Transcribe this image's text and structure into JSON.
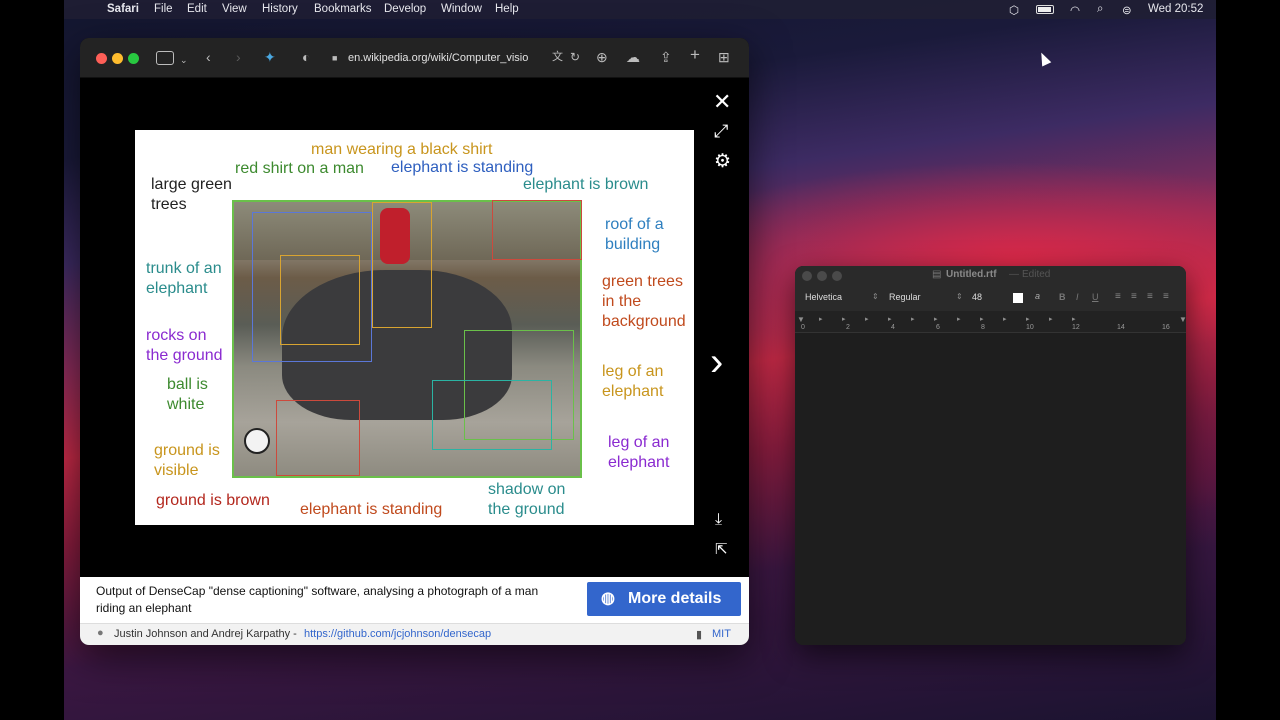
{
  "menubar": {
    "app": "Safari",
    "items": [
      "File",
      "Edit",
      "View",
      "History",
      "Bookmarks",
      "Develop",
      "Window",
      "Help"
    ],
    "clock": "Wed 20:52"
  },
  "safari": {
    "url": "en.wikipedia.org/wiki/Computer_visio"
  },
  "viewer": {
    "labels": [
      "man wearing a black shirt",
      "red shirt on a man",
      "elephant is standing",
      "large green",
      "trees",
      "elephant is brown",
      "roof of a",
      "building",
      "trunk of an",
      "elephant",
      "green trees",
      "in the",
      "background",
      "rocks on",
      "the ground",
      "ball is",
      "white",
      "leg of an",
      "elephant",
      "ground is",
      "visible",
      "leg of an",
      "elephant",
      "ground is brown",
      "elephant is standing",
      "shadow on",
      "the ground"
    ],
    "caption": "Output of DenseCap \"dense captioning\" software, analysing a photograph of a man riding an elephant",
    "more_details": "More details",
    "credit_author": "Justin Johnson and Andrej Karpathy - ",
    "credit_link": "https://github.com/jcjohnson/densecap",
    "license": "MIT"
  },
  "textedit": {
    "title": "Untitled.rtf",
    "status": "Edited",
    "font": "Helvetica",
    "style": "Regular",
    "size": "48",
    "ruler": [
      "0",
      "2",
      "4",
      "6",
      "8",
      "10",
      "12",
      "14",
      "16"
    ]
  },
  "colors": {
    "green": "#3d8a2f",
    "gold": "#c8951d",
    "blue": "#2e5fbf",
    "teal": "#2a8c8c",
    "orange": "#d07a19",
    "purple": "#8a2ad0",
    "red": "#b3271d",
    "button": "#3366cc"
  }
}
